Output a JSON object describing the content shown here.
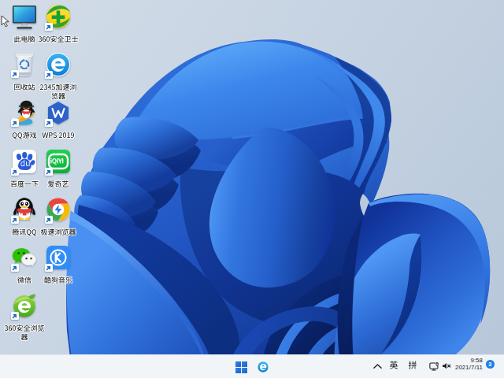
{
  "desktop": {
    "icons": [
      {
        "label": "此电脑"
      },
      {
        "label": "360安全卫士"
      },
      {
        "label": "回收站"
      },
      {
        "label": "2345加速浏览器"
      },
      {
        "label": "QQ游戏"
      },
      {
        "label": "WPS 2019"
      },
      {
        "label": "百度一下"
      },
      {
        "label": "爱奇艺"
      },
      {
        "label": "腾讯QQ"
      },
      {
        "label": "极速浏览器"
      },
      {
        "label": "微信"
      },
      {
        "label": "酷狗音乐"
      },
      {
        "label": "360安全浏览器"
      }
    ]
  },
  "taskbar": {
    "buttons": [
      {
        "name": "start"
      },
      {
        "name": "2345-browser"
      }
    ],
    "tray": {
      "hidden_icons": "^",
      "ime_english": "英",
      "ime_pinyin": "拼",
      "time": "9:58",
      "date": "2021/7/11",
      "notification_count": "3"
    },
    "colors": {
      "taskbar_bg": "#f2f5f8",
      "badge_blue": "#1f80e8"
    }
  }
}
